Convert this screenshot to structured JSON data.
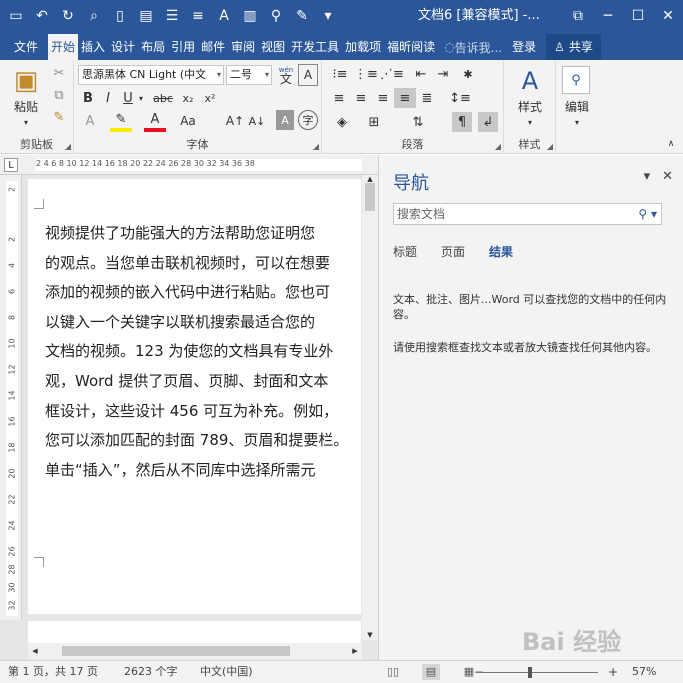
{
  "window": {
    "title": "文档6 [兼容模式] -...",
    "controls": [
      "⧉",
      "─",
      "☐",
      "✕"
    ]
  },
  "quick_access": [
    "save-icon",
    "undo-icon",
    "redo-icon",
    "print-preview-icon",
    "new-icon",
    "paste-icon",
    "list-icon",
    "align-icon",
    "font-color-icon",
    "columns-icon",
    "find-icon",
    "edit-icon",
    "more-icon"
  ],
  "tabs": [
    {
      "label": "文件"
    },
    {
      "label": "开始"
    },
    {
      "label": "插入"
    },
    {
      "label": "设计"
    },
    {
      "label": "布局"
    },
    {
      "label": "引用"
    },
    {
      "label": "邮件"
    },
    {
      "label": "审阅"
    },
    {
      "label": "视图"
    },
    {
      "label": "开发工具"
    },
    {
      "label": "加载项"
    },
    {
      "label": "福昕阅读"
    }
  ],
  "tell_me": "告诉我...",
  "sign_in": "登录",
  "share": "共享",
  "ribbon": {
    "clipboard": {
      "label": "剪贴板",
      "paste": "粘贴"
    },
    "font": {
      "label": "字体",
      "font_name": "思源黑体 CN Light (中文",
      "font_size": "二号",
      "wen": "wén",
      "wen_char": "文"
    },
    "paragraph": {
      "label": "段落"
    },
    "styles": {
      "label": "样式",
      "button": "样式"
    },
    "editing": {
      "button": "编辑"
    }
  },
  "ruler": {
    "h_ticks": "2   4   6   8  10  12  14  16  18  20  22  24  26  28  30  32  34  36  38",
    "v_ticks": [
      "2",
      "2",
      "4",
      "6",
      "8",
      "10",
      "12",
      "14",
      "16",
      "18",
      "20",
      "22",
      "24",
      "26",
      "28",
      "30",
      "32"
    ]
  },
  "document": {
    "lines": [
      "视频提供了功能强大的方法帮助您证明您",
      "的观点。当您单击联机视频时，可以在想要",
      "添加的视频的嵌入代码中进行粘贴。您也可",
      "以键入一个关键字以联机搜索最适合您的",
      "文档的视频。123 为使您的文档具有专业外",
      "观，Word 提供了页眉、页脚、封面和文本",
      "框设计，这些设计 456 可互为补充。例如，",
      "您可以添加匹配的封面 789、页眉和提要栏。",
      "单击“插入”，然后从不同库中选择所需元"
    ]
  },
  "nav": {
    "title": "导航",
    "search_placeholder": "搜索文档",
    "tabs": [
      "标题",
      "页面",
      "结果"
    ],
    "msg1": "文本、批注、图片...Word 可以查找您的文档中的任何内容。",
    "msg2": "请使用搜索框查找文本或者放大镜查找任何其他内容。"
  },
  "status": {
    "page": "第 1 页，共 17 页",
    "words": "2623 个字",
    "language": "中文(中国)",
    "zoom": "57%",
    "zoom_fraction": 0.43
  },
  "watermark": "Bai 经验"
}
